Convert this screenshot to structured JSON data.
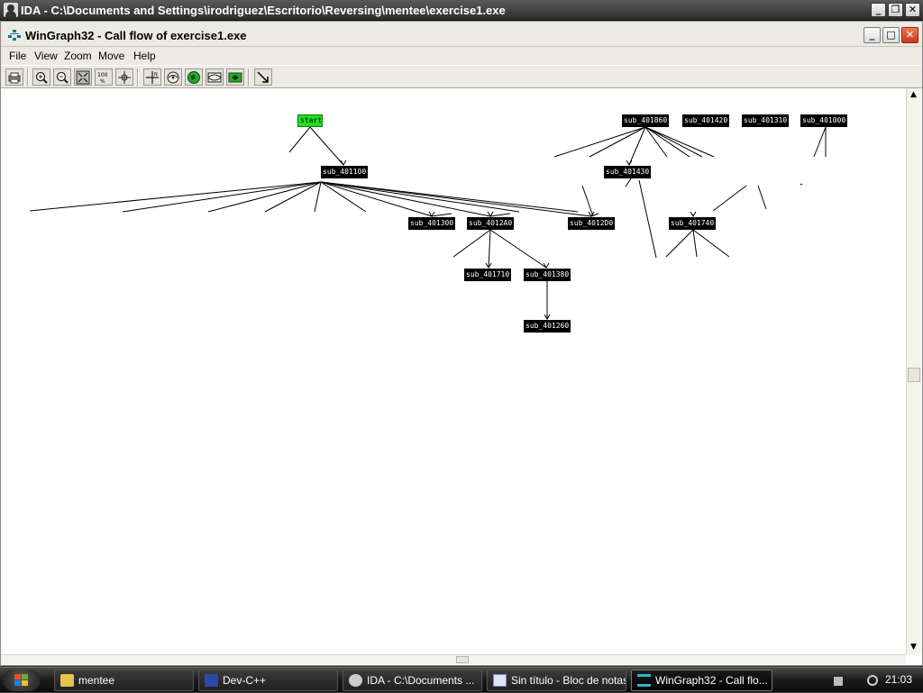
{
  "ida_window": {
    "title": "IDA - C:\\Documents and Settings\\irodriguez\\Escritorio\\Reversing\\mentee\\exercise1.exe"
  },
  "wingraph_window": {
    "title": "WinGraph32 - Call flow of exercise1.exe",
    "menu": [
      "File",
      "View",
      "Zoom",
      "Move",
      "Help"
    ],
    "toolbar": [
      "print-icon",
      "zoom-in-icon",
      "zoom-out-icon",
      "fit-window-icon",
      "zoom-100-icon",
      "center-icon",
      "north-icon",
      "orbit-icon",
      "globe-icon",
      "fisheye-icon",
      "fisheye-green-icon",
      "change-layout-icon"
    ]
  },
  "graph": {
    "nodes": [
      {
        "id": "start",
        "label": "start",
        "color": "#22dd22"
      },
      {
        "id": "n401100",
        "label": "sub_401100"
      },
      {
        "id": "n401300",
        "label": "sub_401300"
      },
      {
        "id": "n4012A0",
        "label": "sub_4012A0"
      },
      {
        "id": "n4012D0",
        "label": "sub_4012D0"
      },
      {
        "id": "n401710",
        "label": "sub_401710"
      },
      {
        "id": "n401380",
        "label": "sub_401380"
      },
      {
        "id": "n401260",
        "label": "sub_401260"
      },
      {
        "id": "n401860",
        "label": "sub_401860"
      },
      {
        "id": "n401420",
        "label": "sub_401420"
      },
      {
        "id": "n401310",
        "label": "sub_401310"
      },
      {
        "id": "n401000",
        "label": "sub_401000"
      },
      {
        "id": "n401430",
        "label": "sub_401430"
      },
      {
        "id": "n401740",
        "label": "sub_401740"
      }
    ]
  },
  "taskbar": {
    "tasks": [
      {
        "label": "mentee",
        "icon": "folder-icon"
      },
      {
        "label": "Dev-C++",
        "icon": "devcpp-icon"
      },
      {
        "label": "IDA - C:\\Documents ...",
        "icon": "ida-icon"
      },
      {
        "label": "Sin título - Bloc de notas",
        "icon": "notepad-icon"
      },
      {
        "label": "WinGraph32 - Call flo...",
        "icon": "wingraph-icon",
        "active": true
      }
    ],
    "clock": "21:03"
  }
}
